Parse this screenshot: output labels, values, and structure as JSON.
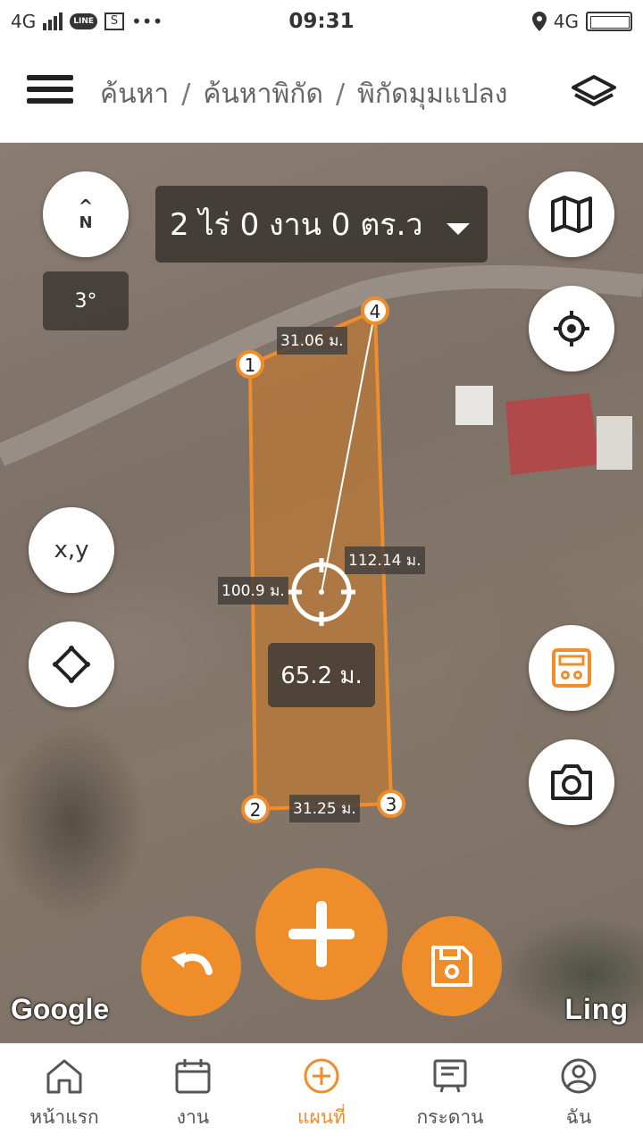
{
  "status_bar": {
    "network_left": "4G",
    "time": "09:31",
    "network_right": "4G",
    "line_badge": "LINE",
    "sim_icon_letter": "S",
    "more_dots": "•••"
  },
  "header": {
    "breadcrumb": [
      "ค้นหา",
      "ค้นหาพิกัด",
      "พิกัดมุมแปลง"
    ],
    "separator": "/"
  },
  "map": {
    "compass_letter": "N",
    "compass_arrow": "^",
    "heading": "3°",
    "area": "2 ไร่ 0 งาน 0 ตร.ว",
    "xy_button": "x,y",
    "points": [
      "1",
      "2",
      "3",
      "4"
    ],
    "edge_labels": {
      "top": "31.06 ม.",
      "right": "112.14 ม.",
      "left": "100.9 ม.",
      "bottom": "31.25 ม."
    },
    "distance": "65.2 ม.",
    "google_attribution": "Google",
    "provider": "Ling"
  },
  "bottom_nav": {
    "items": [
      {
        "label": "หน้าแรก",
        "icon": "home-icon",
        "active": false
      },
      {
        "label": "งาน",
        "icon": "calendar-icon",
        "active": false
      },
      {
        "label": "แผนที่",
        "icon": "plus-circle-icon",
        "active": true
      },
      {
        "label": "กระดาน",
        "icon": "board-icon",
        "active": false
      },
      {
        "label": "ฉัน",
        "icon": "user-icon",
        "active": false
      }
    ]
  },
  "colors": {
    "accent": "#ef8d2b",
    "parcel_fill": "#c97a2a",
    "overlay_box": "#46403a"
  }
}
